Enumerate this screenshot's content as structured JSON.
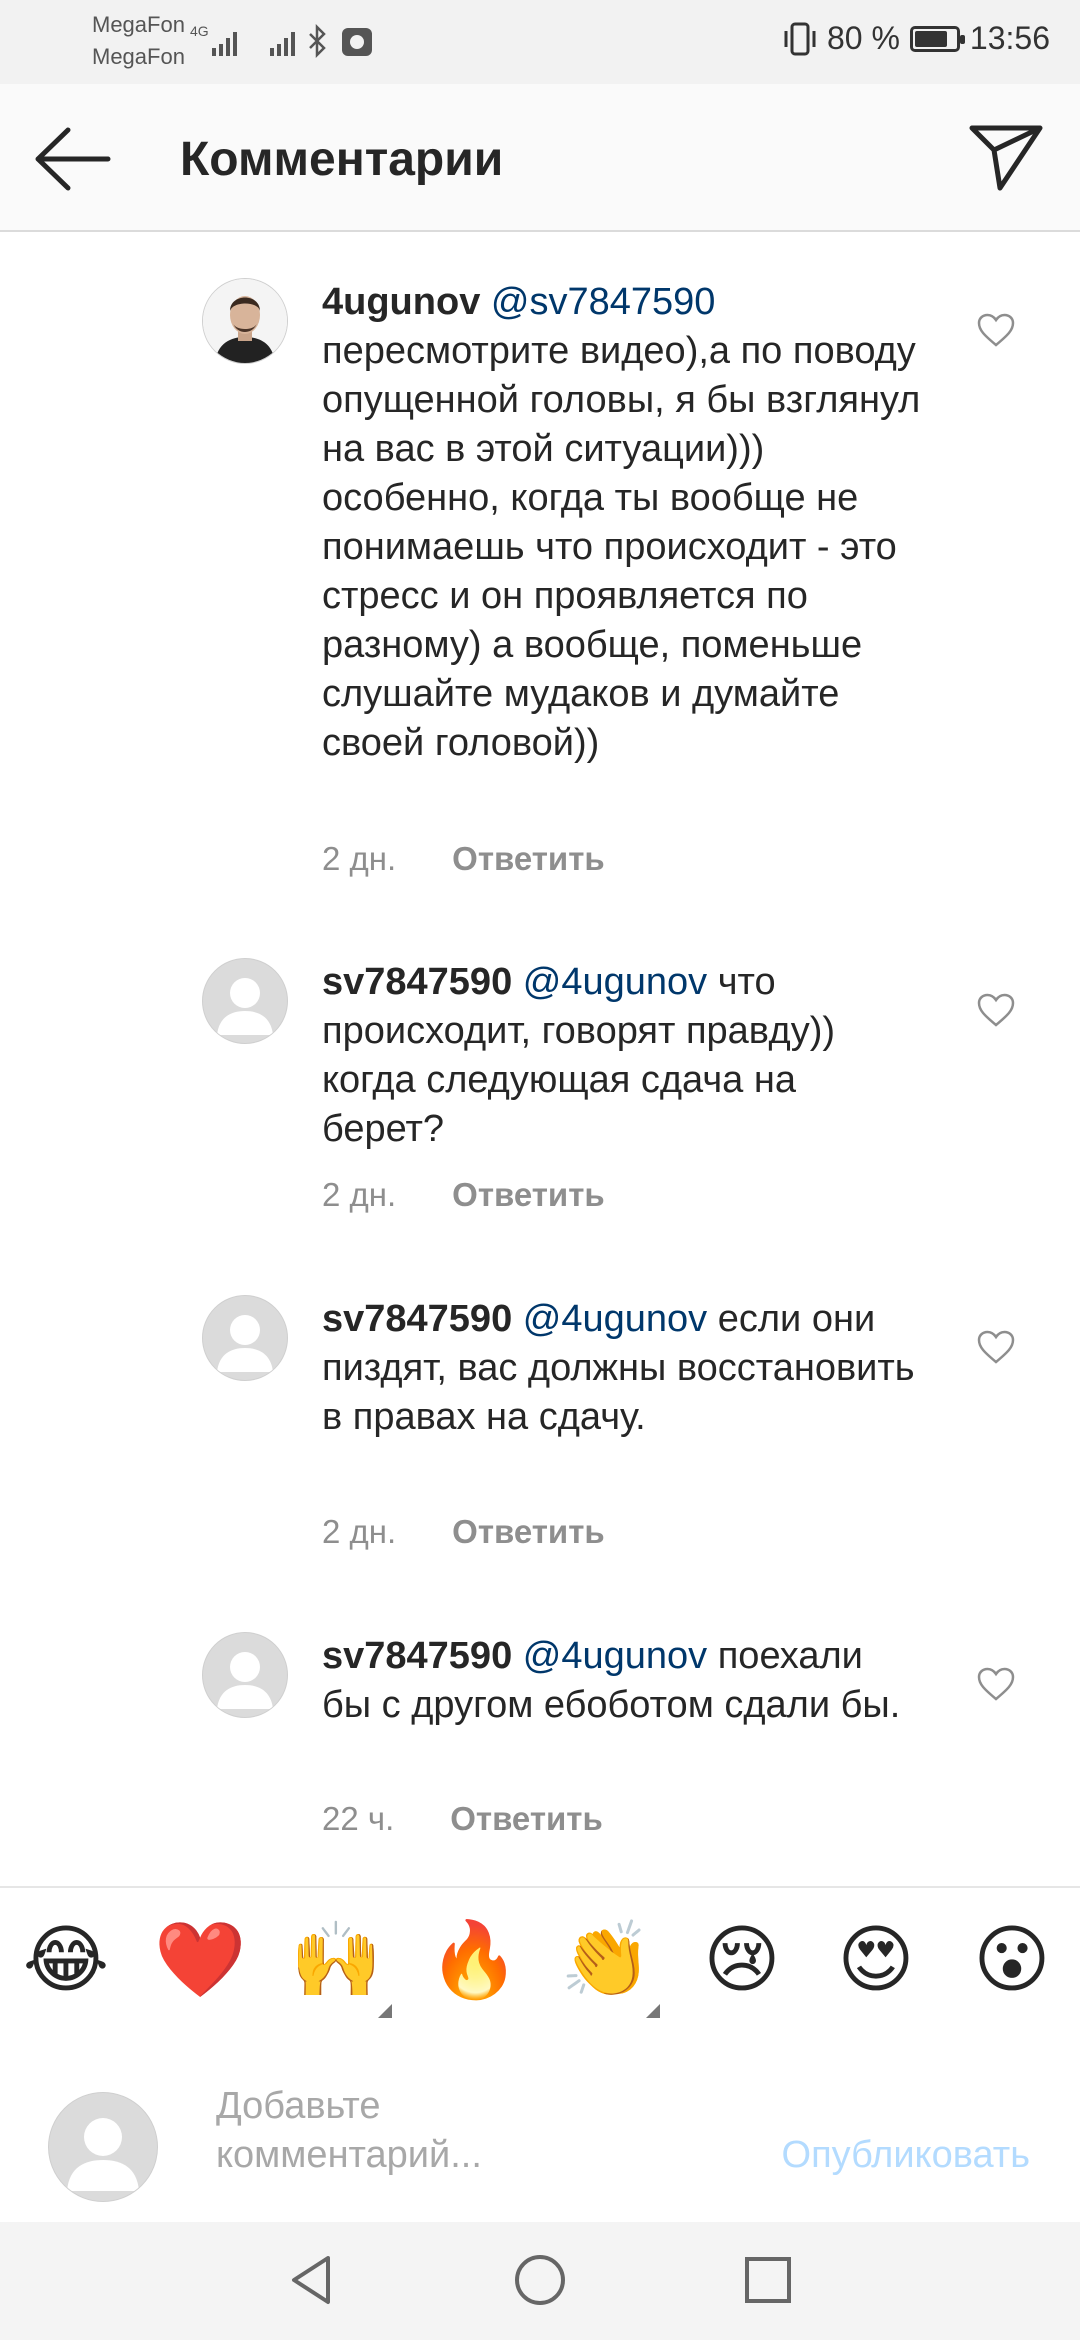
{
  "status_bar": {
    "carrier1": "MegaFon",
    "carrier2": "MegaFon",
    "network": "4G",
    "battery_text": "80 %",
    "battery_level": 0.8,
    "time": "13:56"
  },
  "header": {
    "title": "Комментарии",
    "back_icon": "arrow-left-icon",
    "share_icon": "paper-plane-icon"
  },
  "comments": [
    {
      "username": "4ugunov",
      "mention": "@sv7847590",
      "text": "пересмотрите видео),а по поводу опущенной головы, я бы взглянул на вас в этой ситуации))) особенно, когда ты вообще не понимаешь что происходит - это стресс и он проявляется по разному) а вообще, поменьше слушайте мудаков и думайте своей головой))",
      "time": "2 дн.",
      "reply": "Ответить",
      "avatar": "photo"
    },
    {
      "username": "sv7847590",
      "mention": "@4ugunov",
      "text": "что происходит, говорят правду)) когда следующая сдача на берет?",
      "time": "2 дн.",
      "reply": "Ответить",
      "avatar": "default"
    },
    {
      "username": "sv7847590",
      "mention": "@4ugunov",
      "text": "если они пиздят, вас должны восстановить в правах на сдачу.",
      "time": "2 дн.",
      "reply": "Ответить",
      "avatar": "default"
    },
    {
      "username": "sv7847590",
      "mention": "@4ugunov",
      "text": "поехали бы с другом ебоботом сдали бы.",
      "time": "22 ч.",
      "reply": "Ответить",
      "avatar": "default"
    }
  ],
  "emoji_bar": [
    "😂",
    "❤️",
    "🙌",
    "🔥",
    "👏",
    "😢",
    "😍",
    "😮"
  ],
  "input": {
    "placeholder": "Добавьте комментарий...",
    "publish_label": "Опубликовать"
  },
  "colors": {
    "mention": "#00376b",
    "meta": "#8e8e8e",
    "publish_disabled": "#b3dbff",
    "header_bg": "#fafafa"
  }
}
